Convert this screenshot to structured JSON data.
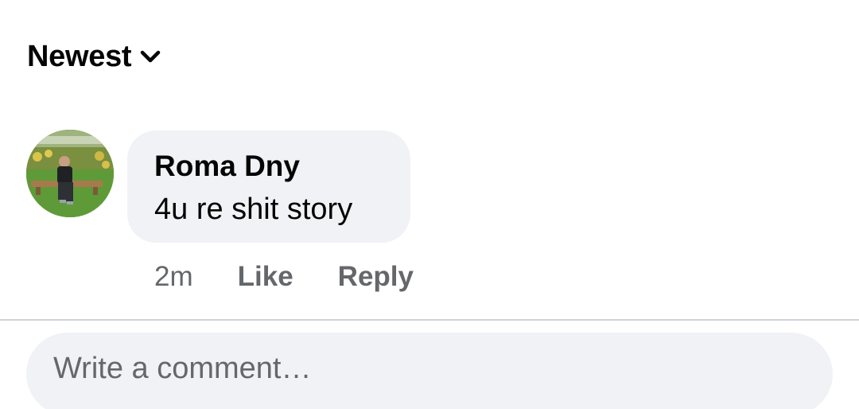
{
  "sort": {
    "label": "Newest",
    "icon": "chevron-down-icon"
  },
  "comment": {
    "author": "Roma Dny",
    "text": "4u re shit story",
    "time": "2m",
    "like_label": "Like",
    "reply_label": "Reply",
    "avatar_icon": "user-avatar-photo"
  },
  "composer": {
    "placeholder": "Write a comment…"
  },
  "colors": {
    "bubble_background": "#f0f2f5",
    "secondary_text": "#65676b",
    "primary_text": "#050505",
    "divider": "#cfd2d6"
  }
}
